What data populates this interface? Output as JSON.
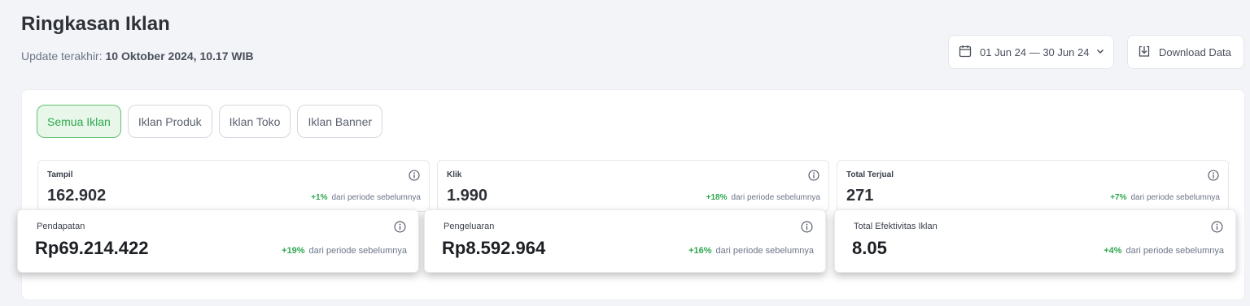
{
  "header": {
    "title": "Ringkasan Iklan",
    "updated_prefix": "Update terakhir:",
    "updated_value": "10 Oktober 2024, 10.17 WIB",
    "date_range": "01 Jun 24 — 30 Jun 24",
    "download_label": "Download Data"
  },
  "tabs": [
    {
      "label": "Semua Iklan",
      "active": true
    },
    {
      "label": "Iklan Produk",
      "active": false
    },
    {
      "label": "Iklan Toko",
      "active": false
    },
    {
      "label": "Iklan Banner",
      "active": false
    }
  ],
  "small_cards": [
    {
      "label": "Tampil",
      "value": "162.902",
      "change": "+1%",
      "change_text": "dari periode sebelumnya"
    },
    {
      "label": "Klik",
      "value": "1.990",
      "change": "+18%",
      "change_text": "dari periode sebelumnya"
    },
    {
      "label": "Total Terjual",
      "value": "271",
      "change": "+7%",
      "change_text": "dari periode sebelumnya"
    }
  ],
  "large_cards": [
    {
      "label": "Pendapatan",
      "value": "Rp69.214.422",
      "change": "+19%",
      "change_text": "dari periode sebelumnya"
    },
    {
      "label": "Pengeluaran",
      "value": "Rp8.592.964",
      "change": "+16%",
      "change_text": "dari periode sebelumnya"
    },
    {
      "label": "Total Efektivitas Iklan",
      "value": "8.05",
      "change": "+4%",
      "change_text": "dari periode sebelumnya"
    }
  ],
  "colors": {
    "accent_green": "#2fa84f",
    "active_tab_bg": "#e8f7ea"
  },
  "icons": {
    "date": "calendar-icon",
    "download": "download-icon",
    "dropdown": "chevron-down-icon",
    "info": "info-icon"
  }
}
